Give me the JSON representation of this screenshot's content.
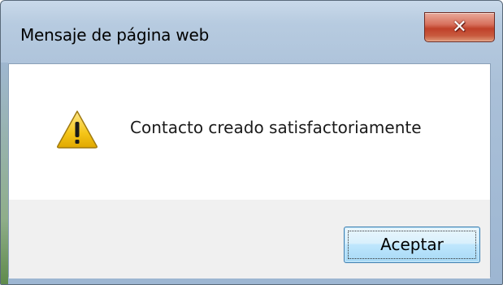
{
  "dialog": {
    "title": "Mensaje de página web",
    "close_icon": "close-icon",
    "message": {
      "icon": "warning-icon",
      "text": "Contacto creado satisfactoriamente"
    },
    "buttons": {
      "ok_label": "Aceptar"
    }
  },
  "colors": {
    "frame": "#aac0d8",
    "close_button": "#c0412a",
    "button_panel": "#f0f0f0",
    "ok_button_border": "#3c7fb1",
    "warning_fill": "#f5c518"
  }
}
